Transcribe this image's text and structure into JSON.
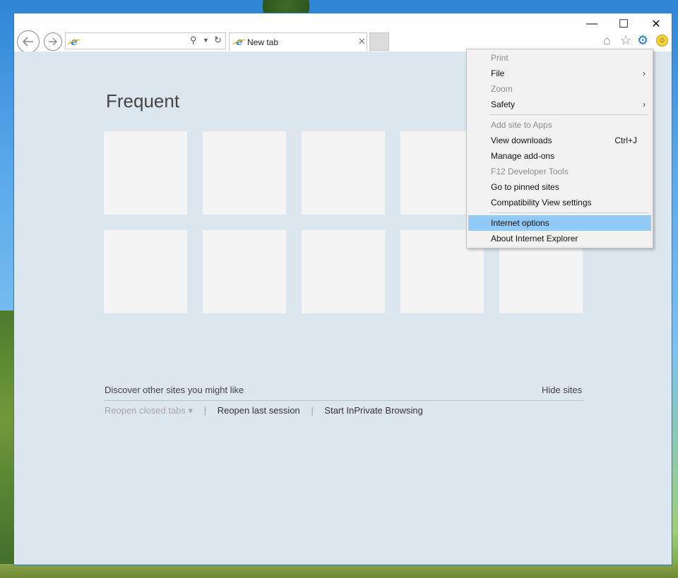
{
  "window_controls": {
    "minimize": "—",
    "maximize": "☐",
    "close": "✕"
  },
  "nav": {
    "back_icon": "back-arrow-icon",
    "forward_icon": "forward-arrow-icon"
  },
  "address_bar": {
    "value": "",
    "placeholder": ""
  },
  "tab": {
    "label": "New tab",
    "close": "✕"
  },
  "toolbar": {
    "home": "⌂",
    "favorites": "☆",
    "tools": "⚙",
    "feedback": "☺"
  },
  "content": {
    "frequent_title": "Frequent",
    "discover_text": "Discover other sites you might like",
    "hide_sites": "Hide sites",
    "reopen_closed_tabs": "Reopen closed tabs ▾",
    "reopen_last_session": "Reopen last session",
    "start_inprivate": "Start InPrivate Browsing",
    "separator": "|"
  },
  "menu": {
    "items": [
      {
        "label": "Print",
        "disabled": true
      },
      {
        "label": "File",
        "arrow": "›"
      },
      {
        "label": "Zoom",
        "disabled": true
      },
      {
        "label": "Safety",
        "arrow": "›"
      },
      {
        "label": "Add site to Apps",
        "disabled": true
      },
      {
        "label": "View downloads",
        "shortcut": "Ctrl+J"
      },
      {
        "label": "Manage add-ons"
      },
      {
        "label": "F12 Developer Tools",
        "disabled": true
      },
      {
        "label": "Go to pinned sites"
      },
      {
        "label": "Compatibility View settings"
      },
      {
        "label": "Internet options",
        "highlighted": true
      },
      {
        "label": "About Internet Explorer"
      }
    ]
  },
  "colors": {
    "accent": "#1672c4",
    "menu_highlight": "#91c9f7",
    "content_bg": "#dce6ef"
  }
}
